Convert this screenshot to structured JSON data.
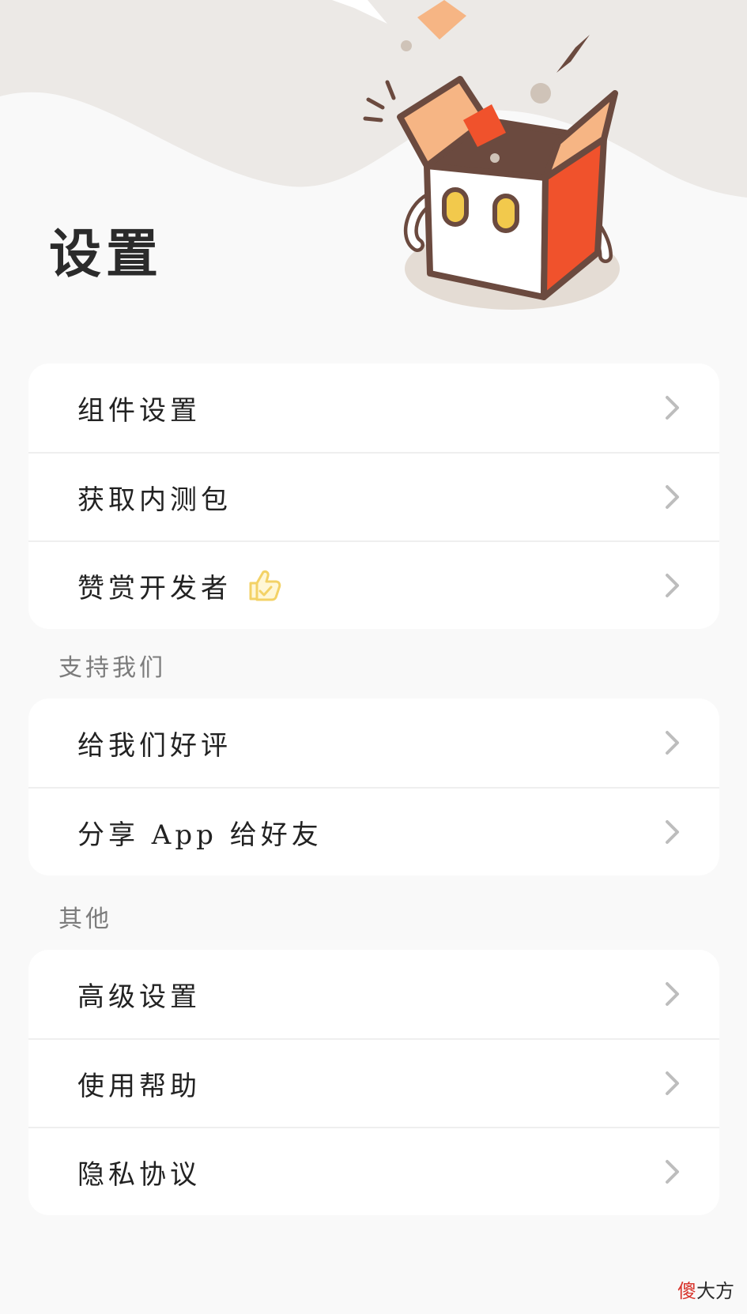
{
  "header": {
    "title": "设置"
  },
  "groups": [
    {
      "items": [
        {
          "label": "组件设置"
        },
        {
          "label": "获取内测包"
        },
        {
          "label": "赞赏开发者",
          "badge_icon": "thumbs-up-icon"
        }
      ]
    },
    {
      "section_label": "支持我们",
      "items": [
        {
          "label": "给我们好评"
        },
        {
          "label": "分享 App 给好友"
        }
      ]
    },
    {
      "section_label": "其他",
      "items": [
        {
          "label": "高级设置"
        },
        {
          "label": "使用帮助"
        },
        {
          "label": "隐私协议"
        }
      ]
    }
  ],
  "watermark": {
    "part1": "傻",
    "part2": "大方"
  },
  "colors": {
    "background": "#f9f9f9",
    "header_wave": "#ece9e6",
    "card": "#ffffff",
    "mascot_outline": "#6b4a3f",
    "mascot_orange": "#f0522c",
    "mascot_peach": "#f6b584",
    "mascot_eyes": "#f2c94c",
    "thumb_yellow": "#f3d266",
    "chevron": "#bdbdbd"
  }
}
